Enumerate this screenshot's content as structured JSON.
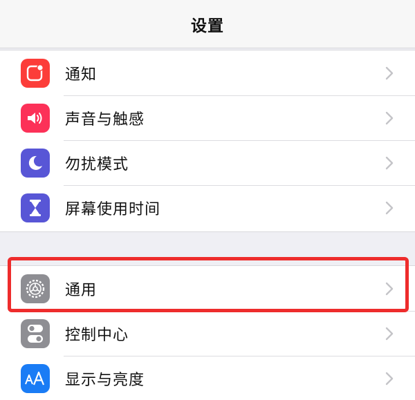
{
  "nav": {
    "title": "设置"
  },
  "groups": [
    {
      "rows": [
        {
          "label": "通知",
          "icon": "notifications-icon",
          "color": "#fc3d39"
        },
        {
          "label": "声音与触感",
          "icon": "sound-icon",
          "color": "#fc3158"
        },
        {
          "label": "勿扰模式",
          "icon": "moon-icon",
          "color": "#5856d6"
        },
        {
          "label": "屏幕使用时间",
          "icon": "hourglass-icon",
          "color": "#5856d6"
        }
      ]
    },
    {
      "rows": [
        {
          "label": "通用",
          "icon": "gear-icon",
          "color": "#8e8e93"
        },
        {
          "label": "控制中心",
          "icon": "toggles-icon",
          "color": "#8e8e93"
        },
        {
          "label": "显示与亮度",
          "icon": "text-size-icon",
          "color": "#1a7cf5"
        }
      ]
    }
  ],
  "annotation": {
    "highlight_color": "#ee2c2c",
    "highlighted_row": "通用"
  }
}
